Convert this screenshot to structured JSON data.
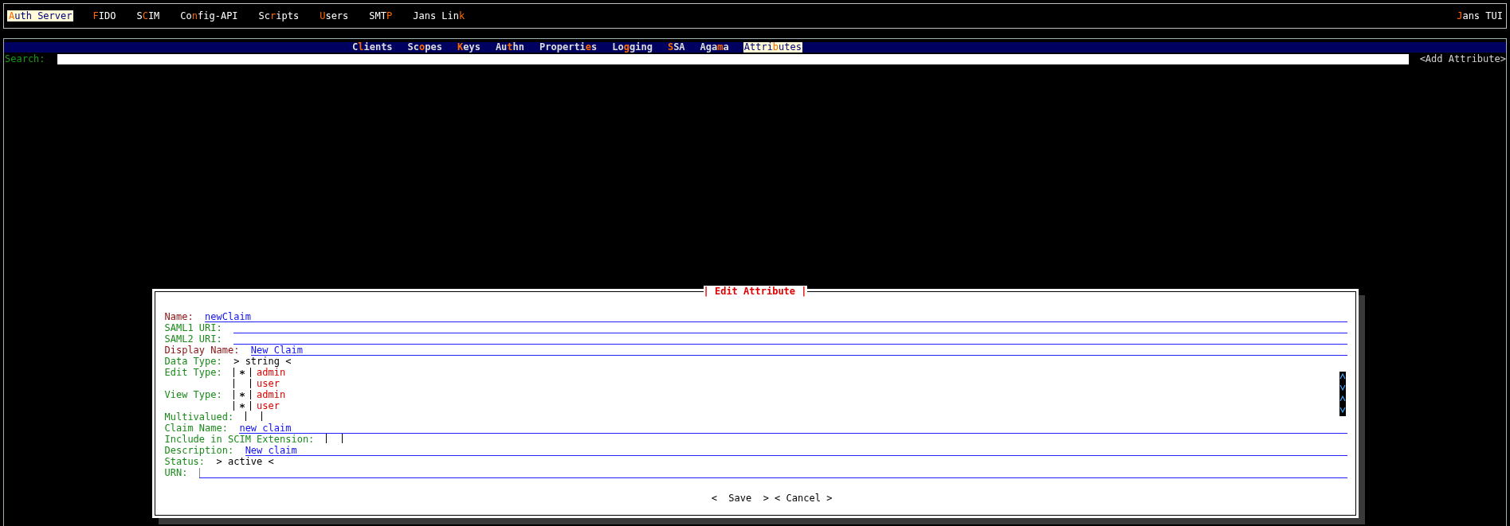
{
  "top_menu": {
    "items": [
      {
        "label": "**A**uth Server",
        "selected": true
      },
      {
        "label": "**F**IDO",
        "selected": false
      },
      {
        "label": "S**C**IM",
        "selected": false
      },
      {
        "label": "Co**n**fig-API",
        "selected": false
      },
      {
        "label": "Sc**r**ipts",
        "selected": false
      },
      {
        "label": "**U**sers",
        "selected": false
      },
      {
        "label": "SMT**P**",
        "selected": false
      },
      {
        "label": "Jans Lin**k**",
        "selected": false
      }
    ],
    "app_name": "**J**ans TUI"
  },
  "tabs": [
    {
      "label": "C**l**ients",
      "selected": false
    },
    {
      "label": "Sc**o**pes",
      "selected": false
    },
    {
      "label": "**K**eys",
      "selected": false
    },
    {
      "label": "Au**t**hn",
      "selected": false
    },
    {
      "label": "Properti**e**s",
      "selected": false
    },
    {
      "label": "Lo**g**ging",
      "selected": false
    },
    {
      "label": "**S**SA",
      "selected": false
    },
    {
      "label": "Aga**m**a",
      "selected": false
    },
    {
      "label": "Attri**b**utes",
      "selected": true
    }
  ],
  "search": {
    "label": "Search:"
  },
  "add_button": "<Add Attribute>",
  "dialog": {
    "title": "| Edit Attribute |",
    "fields": [
      {
        "kind": "text",
        "label": "Name:",
        "required": true,
        "value": "newClaim"
      },
      {
        "kind": "text",
        "label": "SAML1 URI:",
        "required": false
      },
      {
        "kind": "text",
        "label": "SAML2 URI:",
        "required": false
      },
      {
        "kind": "text",
        "label": "Display Name:",
        "required": true,
        "value": "New Claim"
      },
      {
        "kind": "select",
        "label": "Data Type:",
        "value": "> string <"
      },
      {
        "kind": "checklist",
        "label": "Edit Type:",
        "options": [
          {
            "label": "admin",
            "checked": true
          },
          {
            "label": "user",
            "checked": false
          }
        ]
      },
      {
        "kind": "checklist",
        "label": "View Type:",
        "options": [
          {
            "label": "admin",
            "checked": true
          },
          {
            "label": "user",
            "checked": true
          }
        ]
      },
      {
        "kind": "checkbox",
        "label": "Multivalued:",
        "checked": false
      },
      {
        "kind": "text",
        "label": "Claim Name:",
        "required": false,
        "value": "new_claim"
      },
      {
        "kind": "checkbox",
        "label": "Include in SCIM Extension:",
        "checked": false
      },
      {
        "kind": "text",
        "label": "Description:",
        "required": false,
        "value": "New claim"
      },
      {
        "kind": "select",
        "label": "Status:",
        "value": "> active <"
      },
      {
        "kind": "text",
        "label": "URN:",
        "required": false,
        "cursor": true
      }
    ],
    "buttons": [
      "<  Save  >",
      "< Cancel >"
    ]
  }
}
